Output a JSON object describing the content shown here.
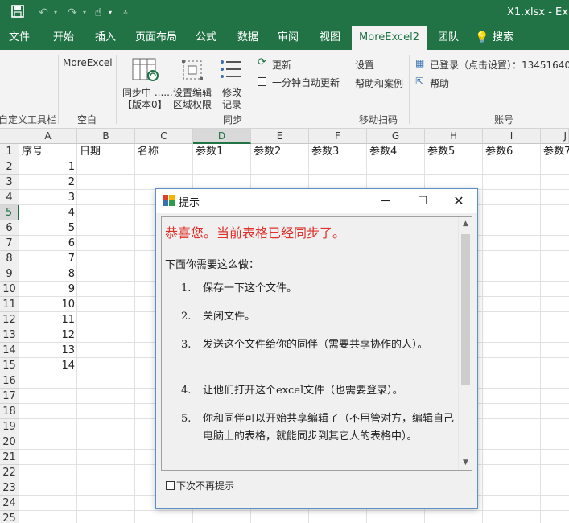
{
  "window": {
    "title": "X1.xlsx - Ex"
  },
  "tabs": [
    "文件",
    "开始",
    "插入",
    "页面布局",
    "公式",
    "数据",
    "审阅",
    "视图",
    "MoreExcel2",
    "团队",
    "搜索"
  ],
  "ribbon": {
    "group_custom_toolbar": "自定义工具栏",
    "group_blank": "空白",
    "moreexcel_label": "MoreExcel",
    "sync_btn_line1": "同步中 ......",
    "sync_btn_line2": "【版本0】",
    "set_edit_line1": "设置编辑",
    "set_edit_line2": "区域权限",
    "modify_line1": "修改",
    "modify_line2": "记录",
    "group_sync": "同步",
    "update_btn": "更新",
    "auto_update": "一分钟自动更新",
    "settings": "设置",
    "help_cases": "帮助和案例",
    "group_mobile": "移动扫码",
    "logged_in": "已登录（点击设置）：13451640",
    "help": "帮助",
    "group_account": "账号"
  },
  "sheet": {
    "columns": [
      "A",
      "B",
      "C",
      "D",
      "E",
      "F",
      "G",
      "H",
      "I",
      "J"
    ],
    "selected_column": "D",
    "selected_row": 5,
    "rows": [
      "1",
      "2",
      "3",
      "4",
      "5",
      "6",
      "7",
      "8",
      "9",
      "10",
      "11",
      "12",
      "13",
      "14",
      "15",
      "16",
      "17",
      "18",
      "19",
      "20",
      "21",
      "22",
      "23",
      "24",
      "25"
    ],
    "headers": [
      "序号",
      "日期",
      "名称",
      "参数1",
      "参数2",
      "参数3",
      "参数4",
      "参数5",
      "参数6",
      "参数7"
    ],
    "values": [
      "1",
      "2",
      "3",
      "4",
      "5",
      "6",
      "7",
      "8",
      "9",
      "10",
      "11",
      "12",
      "13",
      "14"
    ]
  },
  "dialog": {
    "title": "提示",
    "heading": "恭喜您。当前表格已经同步了。",
    "intro": "下面你需要这么做：",
    "steps": [
      {
        "n": "1.",
        "text": "保存一下这个文件。"
      },
      {
        "n": "2.",
        "text": "关闭文件。"
      },
      {
        "n": "3.",
        "text": "发送这个文件给你的同伴（需要共享协作的人）。"
      },
      {
        "n": "4.",
        "text": "让他们打开这个excel文件（也需要登录）。"
      },
      {
        "n": "5.",
        "text": "你和同伴可以开始共享编辑了（不用管对方，编辑自己电脑上的表格，就能同步到其它人的表格中）。"
      }
    ],
    "dont_show": "下次不再提示"
  },
  "colors": {
    "excel_green": "#217346",
    "heading_red": "#e0302b"
  }
}
